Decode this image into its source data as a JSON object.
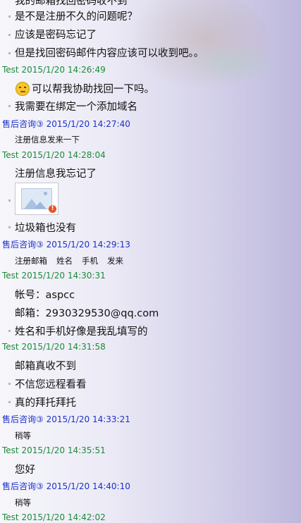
{
  "chat": {
    "top_partial": "我的邮箱找回密码收不到",
    "messages": [
      {
        "t": "是不是注册不久的问题呢？"
      },
      {
        "t": "应该是密码忘记了"
      },
      {
        "t": "但是找回密码邮件内容应该可以收到吧。。"
      }
    ],
    "h1": {
      "sender": "Test",
      "time": "2015/1/20 14:26:49"
    },
    "m1a": "可以帮我协助找回一下吗。",
    "m1b": "我需要在绑定一个添加域名",
    "h2": {
      "sender": "售后咨询③",
      "time": "2015/1/20 14:27:40"
    },
    "m2a": "注册信息发来一下",
    "h3": {
      "sender": "Test",
      "time": "2015/1/20 14:28:04"
    },
    "m3a": "注册信息我忘记了",
    "m3c": "垃圾箱也没有",
    "h4": {
      "sender": "售后咨询③",
      "time": "2015/1/20 14:29:13"
    },
    "m4_fields": [
      "注册邮箱",
      "姓名",
      "手机",
      "发来"
    ],
    "h5": {
      "sender": "Test",
      "time": "2015/1/20 14:30:31"
    },
    "m5a": "帐号：aspcc",
    "m5b": "邮箱：2930329530@qq.com",
    "m5c": "姓名和手机好像是我乱填写的",
    "h6": {
      "sender": "Test",
      "time": "2015/1/20 14:31:58"
    },
    "m6a": "邮箱真收不到",
    "m6b": "不信您远程看看",
    "m6c": "真的拜托拜托",
    "h7": {
      "sender": "售后咨询③",
      "time": "2015/1/20 14:33:21"
    },
    "m7a": "稍等",
    "h8": {
      "sender": "Test",
      "time": "2015/1/20 14:35:51"
    },
    "m8a": "您好",
    "h9": {
      "sender": "售后咨询③",
      "time": "2015/1/20 14:40:10"
    },
    "m9a": "稍等",
    "h10": {
      "sender": "Test",
      "time": "2015/1/20 14:42:02"
    },
    "icons": {
      "emoji": "smile-emoji-icon",
      "image": "broken-image-icon",
      "error": "error-badge-icon"
    },
    "colors": {
      "test_header": "#1c8a3a",
      "service_header": "#1d2fc8"
    }
  }
}
